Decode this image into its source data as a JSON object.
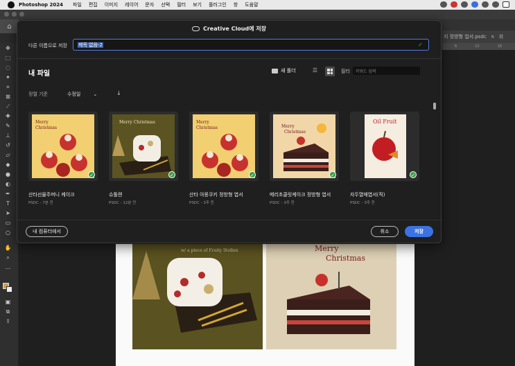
{
  "menubar": {
    "app": "Photoshop 2024",
    "items": [
      "파일",
      "편집",
      "이미지",
      "레이어",
      "문자",
      "선택",
      "필터",
      "보기",
      "플러그인",
      "창",
      "도움말"
    ]
  },
  "doc_tab": {
    "label": "지 정방형 업서.psdc",
    "close": "×",
    "next": "쉬"
  },
  "ruler_marks": [
    "6",
    "12",
    "18"
  ],
  "dialog": {
    "title": "Creative Cloud에 저장",
    "save_as_label": "다른 이름으로 저장",
    "file_name": "제목 없음-2",
    "my_files": "내 파일",
    "new_folder": "새 폴더",
    "filter_label": "필터",
    "filter_placeholder": "키워드 입력",
    "sort_label": "정렬 기준",
    "sort_value": "수정일",
    "files": [
      {
        "name": "산타선물주머니 케이크",
        "meta": "PSDC - 7분 전"
      },
      {
        "name": "슈톨렌",
        "meta": "PSDC - 12분 전"
      },
      {
        "name": "산타 아몽쿠키 정방형 엽서",
        "meta": "PSDC - 3주 전"
      },
      {
        "name": "메리초콜릿케이크 정방형 엽서",
        "meta": "PSDC - 3주 전"
      },
      {
        "name": "자두열매엽서(직)",
        "meta": "PSDC - 3주 전"
      }
    ],
    "btn_computer": "내 컴퓨터에서",
    "btn_cancel": "취소",
    "btn_save": "저장"
  },
  "thumb_text": {
    "merry": "Merry",
    "christmas": "Christmas",
    "oil_fruit": "Oil Fruit",
    "fruity": "w/ a piece of Fruity Stollen"
  }
}
